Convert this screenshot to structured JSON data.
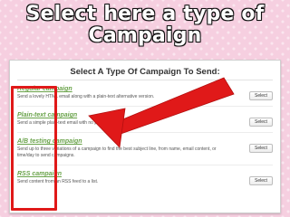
{
  "headline": {
    "line1": "Select here a type of",
    "line2": "Campaign"
  },
  "panel": {
    "title": "Select A Type Of Campaign To Send:"
  },
  "campaigns": [
    {
      "name": "Regular campaign",
      "description": "Send a lovely HTML email along with a plain-text alternative version.",
      "button": "Select"
    },
    {
      "name": "Plain-text campaign",
      "description": "Send a simple plain-text email with no pictures or formatting.",
      "button": "Select"
    },
    {
      "name": "A/B testing campaign",
      "description": "Send up to three variations of a campaign to find the best subject line, from name, email content, or time/day to send campaigns.",
      "button": "Select"
    },
    {
      "name": "RSS campaign",
      "description": "Send content from an RSS feed to a list.",
      "button": "Select"
    }
  ],
  "colors": {
    "accent_green": "#6aa34a",
    "highlight_red": "#e01919",
    "background_pink": "#f6cfe0"
  }
}
